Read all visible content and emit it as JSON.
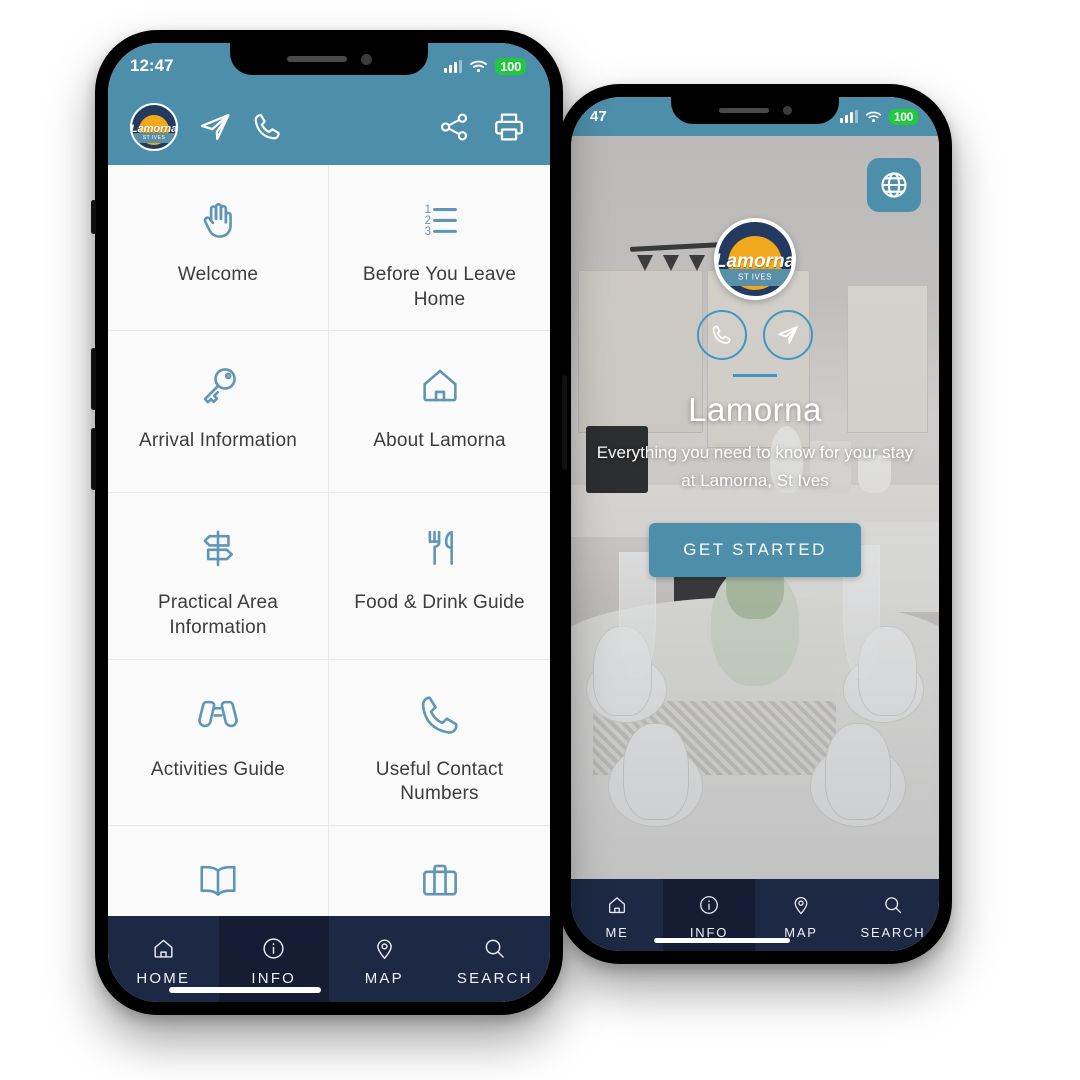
{
  "status_bar": {
    "time_left": "12:47",
    "time_right": "47",
    "battery": "100",
    "signal_icon": "signal-bars-icon",
    "wifi_icon": "wifi-icon"
  },
  "left_phone": {
    "header": {
      "logo_name": "Lamorna",
      "logo_sub": "ST IVES",
      "send_icon": "paper-plane-icon",
      "call_icon": "phone-icon",
      "share_icon": "share-icon",
      "print_icon": "printer-icon"
    },
    "menu_items": [
      {
        "label": "Welcome",
        "icon": "hand-wave-icon"
      },
      {
        "label": "Before You Leave Home",
        "icon": "numbered-list-icon"
      },
      {
        "label": "Arrival Information",
        "icon": "key-icon"
      },
      {
        "label": "About Lamorna",
        "icon": "house-icon"
      },
      {
        "label": "Practical Area Information",
        "icon": "signpost-icon"
      },
      {
        "label": "Food & Drink Guide",
        "icon": "fork-knife-icon"
      },
      {
        "label": "Activities Guide",
        "icon": "binoculars-icon"
      },
      {
        "label": "Useful Contact Numbers",
        "icon": "phone-handset-icon"
      },
      {
        "label": "",
        "icon": "open-book-icon"
      },
      {
        "label": "",
        "icon": "suitcase-icon"
      }
    ],
    "bottom_nav": [
      {
        "label": "HOME",
        "icon": "home-icon",
        "active": false
      },
      {
        "label": "INFO",
        "icon": "info-icon",
        "active": true
      },
      {
        "label": "MAP",
        "icon": "map-pin-icon",
        "active": false
      },
      {
        "label": "SEARCH",
        "icon": "search-icon",
        "active": false
      }
    ]
  },
  "right_phone": {
    "globe_icon": "globe-icon",
    "hero": {
      "logo_name": "Lamorna",
      "logo_sub": "ST IVES",
      "call_icon": "phone-icon",
      "send_icon": "paper-plane-icon",
      "title": "Lamorna",
      "subtitle": "Everything you need to know for your stay at Lamorna, St Ives",
      "cta_label": "GET STARTED"
    },
    "bottom_nav": [
      {
        "label": "ME",
        "icon": "home-icon",
        "active": false
      },
      {
        "label": "INFO",
        "icon": "info-icon",
        "active": true
      },
      {
        "label": "MAP",
        "icon": "map-pin-icon",
        "active": false
      },
      {
        "label": "SEARCH",
        "icon": "search-icon",
        "active": false
      }
    ]
  },
  "colors": {
    "header_blue": "#4d8eab",
    "nav_navy": "#1d2944",
    "nav_navy_active": "#141d33",
    "icon_blue": "#5f96b6",
    "accent_circle": "#3f97c4",
    "battery_green": "#22c93f",
    "card_bg": "#fafafa",
    "logo_navy": "#23395f",
    "logo_sun": "#f2a81d"
  }
}
